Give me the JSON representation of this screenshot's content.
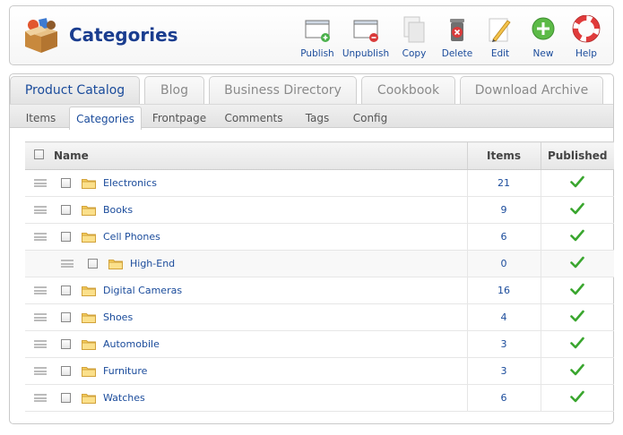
{
  "header": {
    "title": "Categories"
  },
  "toolbar": [
    {
      "label": "Publish",
      "icon": "publish-icon"
    },
    {
      "label": "Unpublish",
      "icon": "unpublish-icon"
    },
    {
      "label": "Copy",
      "icon": "copy-icon"
    },
    {
      "label": "Delete",
      "icon": "delete-icon"
    },
    {
      "label": "Edit",
      "icon": "edit-icon"
    },
    {
      "label": "New",
      "icon": "new-icon"
    },
    {
      "label": "Help",
      "icon": "help-icon"
    }
  ],
  "main_tabs": [
    "Product Catalog",
    "Blog",
    "Business Directory",
    "Cookbook",
    "Download Archive"
  ],
  "sub_tabs": [
    "Items",
    "Categories",
    "Frontpage",
    "Comments",
    "Tags",
    "Config"
  ],
  "table": {
    "headers": {
      "name": "Name",
      "items": "Items",
      "published": "Published"
    },
    "rows": [
      {
        "name": "Electronics",
        "items": "21",
        "level": 0
      },
      {
        "name": "Books",
        "items": "9",
        "level": 0
      },
      {
        "name": "Cell Phones",
        "items": "6",
        "level": 0
      },
      {
        "name": "High-End",
        "items": "0",
        "level": 1
      },
      {
        "name": "Digital Cameras",
        "items": "16",
        "level": 0
      },
      {
        "name": "Shoes",
        "items": "4",
        "level": 0
      },
      {
        "name": "Automobile",
        "items": "3",
        "level": 0
      },
      {
        "name": "Furniture",
        "items": "3",
        "level": 0
      },
      {
        "name": "Watches",
        "items": "6",
        "level": 0
      }
    ]
  },
  "colors": {
    "accent": "#1a4b9b",
    "published_check": "#3aa62f"
  }
}
